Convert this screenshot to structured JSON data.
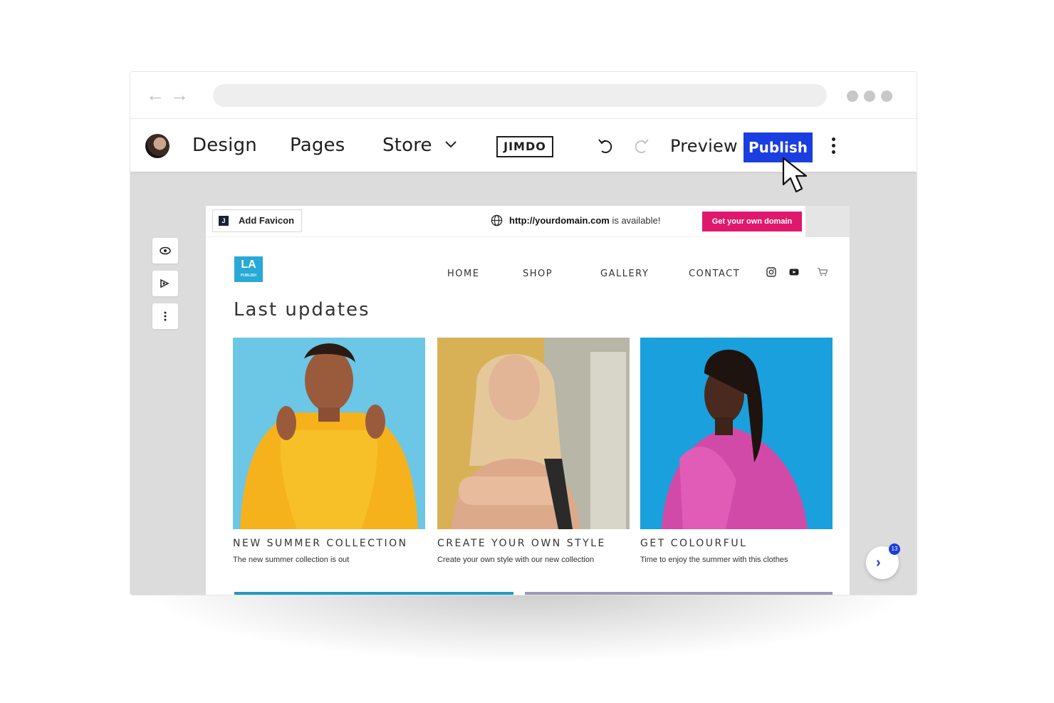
{
  "editor": {
    "toolbar": {
      "design_label": "Design",
      "pages_label": "Pages",
      "store_label": "Store",
      "logo_text": "JIMDO",
      "preview_label": "Preview",
      "publish_label": "Publish"
    }
  },
  "site": {
    "bar": {
      "add_favicon_label": "Add Favicon",
      "favicon_icon_letter": "J",
      "domain_url": "http://yourdomain.com",
      "domain_suffix": " is available!",
      "get_domain_label": "Get your own domain"
    },
    "logo": {
      "main": "LA",
      "sub": "PUBLISH"
    },
    "nav": [
      "HOME",
      "SHOP",
      "GALLERY",
      "CONTACT"
    ],
    "heading": "Last updates",
    "cards": [
      {
        "title": "NEW SUMMER COLLECTION",
        "desc": "The new summer collection is out"
      },
      {
        "title": "CREATE YOUR OWN STYLE",
        "desc": "Create your own style with our new collection"
      },
      {
        "title": "GET COLOURFUL",
        "desc": "Time to enjoy the summer with this clothes"
      }
    ]
  },
  "fab": {
    "badge": "13"
  },
  "colors": {
    "publish": "#1a3ee0",
    "cta_pink": "#e0186d",
    "logo_blue": "#28a9d6",
    "workspace": "#dcdcdc"
  }
}
